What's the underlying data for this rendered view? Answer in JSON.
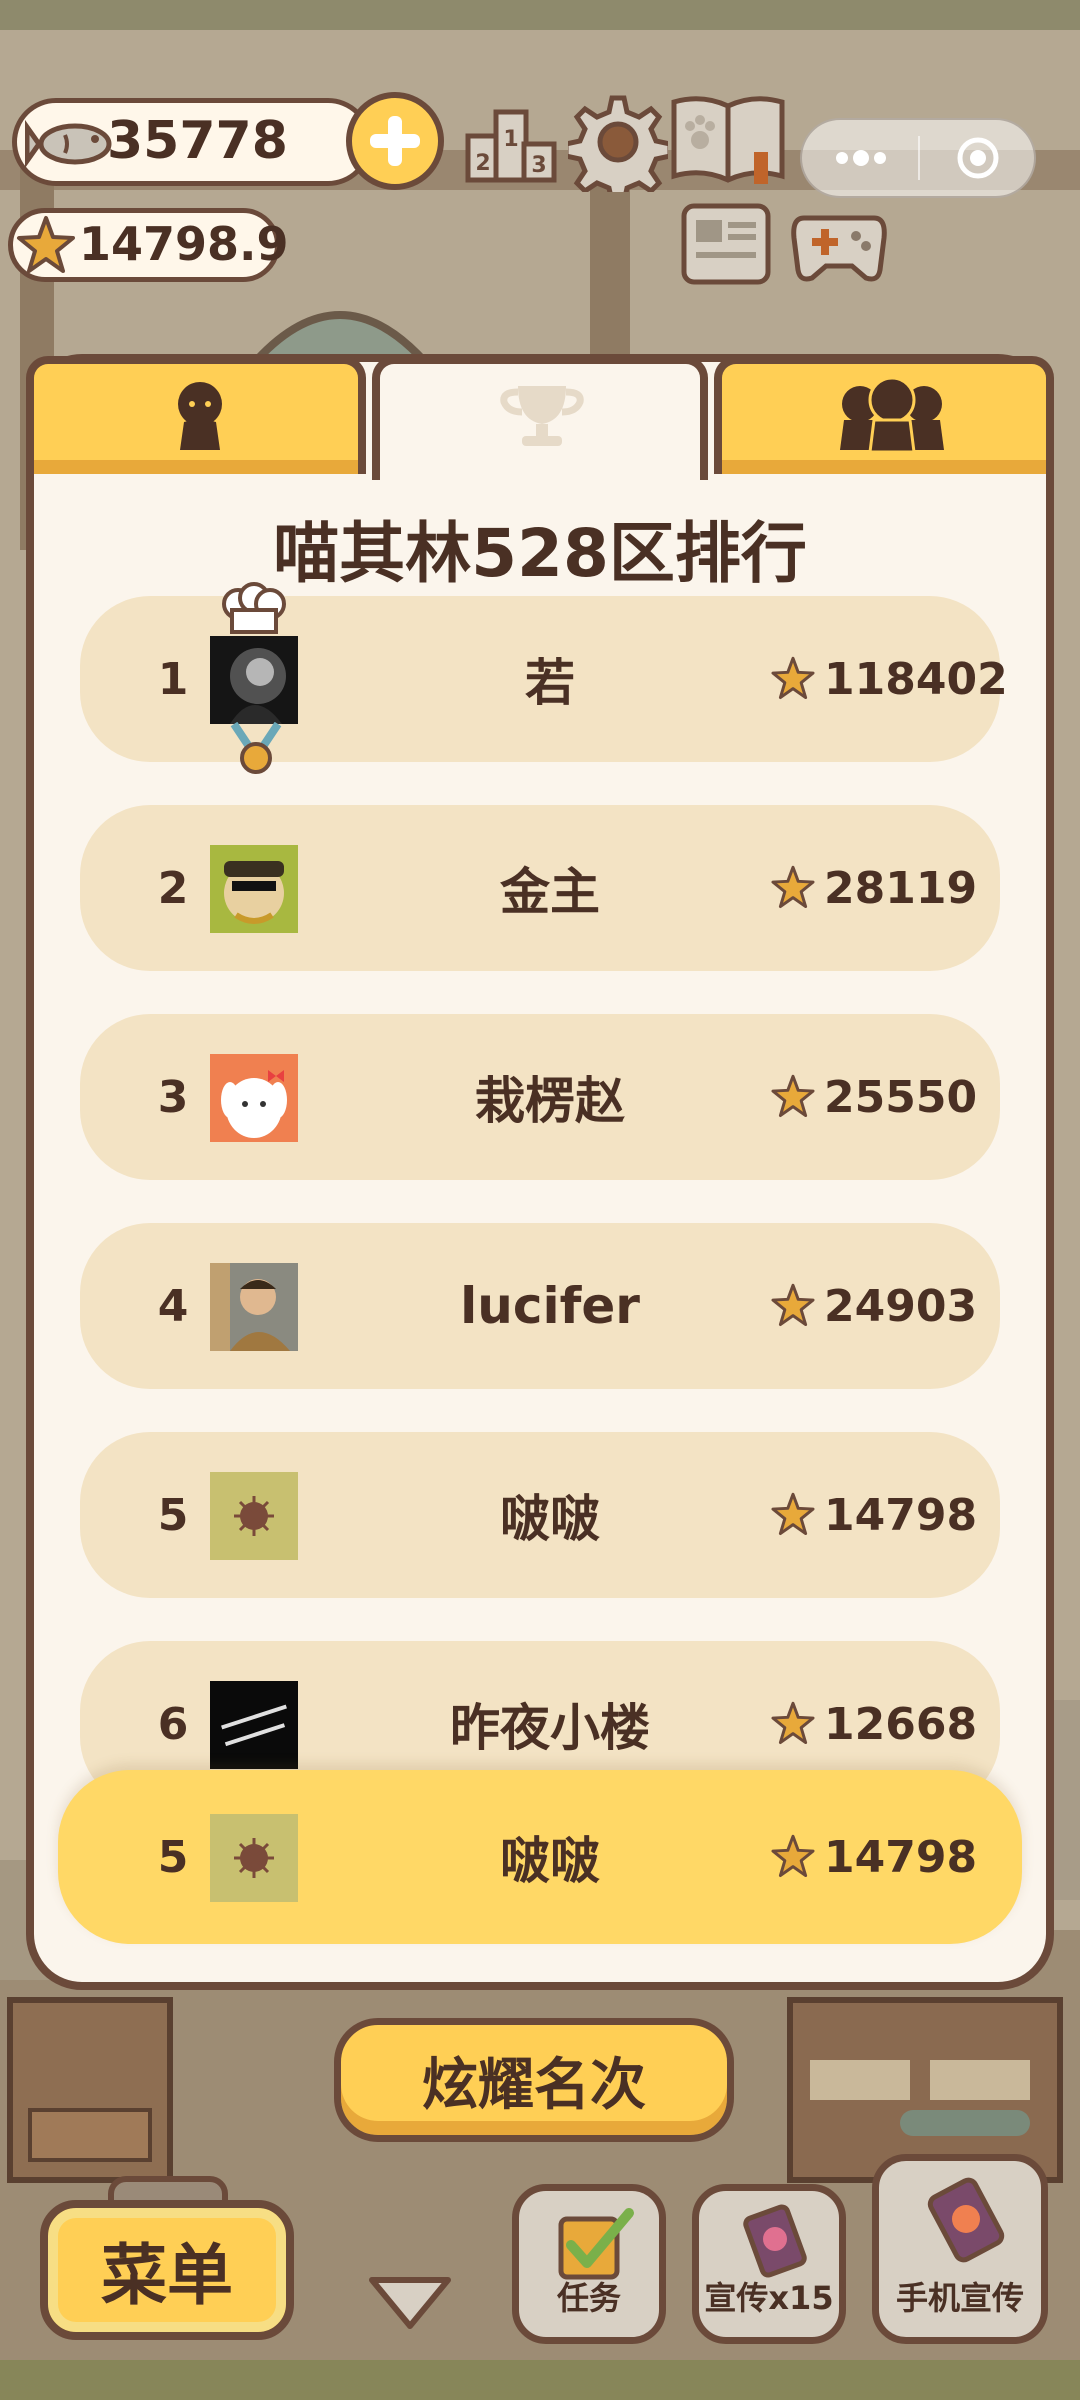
{
  "currencies": {
    "fish": "35778",
    "stars": "14798.9"
  },
  "panel": {
    "title": "喵其林528区排行",
    "tabs": [
      {
        "name": "personal",
        "icon": "single-person-icon"
      },
      {
        "name": "ranking",
        "icon": "trophy-icon",
        "active": true
      },
      {
        "name": "group",
        "icon": "group-icon"
      }
    ],
    "rows": [
      {
        "rank": "1",
        "name": "若",
        "score": "118402"
      },
      {
        "rank": "2",
        "name": "金主",
        "score": "28119"
      },
      {
        "rank": "3",
        "name": "栽楞赵",
        "score": "25550"
      },
      {
        "rank": "4",
        "name": "lucifer",
        "score": "24903"
      },
      {
        "rank": "5",
        "name": "啵啵",
        "score": "14798"
      },
      {
        "rank": "6",
        "name": "昨夜小楼",
        "score": "12668"
      }
    ],
    "me": {
      "rank": "5",
      "name": "啵啵",
      "score": "14798"
    },
    "show_button": "炫耀名次"
  },
  "bottom": {
    "menu": "菜单",
    "tasks": "任务",
    "promo": "宣传x15",
    "phone_promo": "手机宣传"
  },
  "colors": {
    "accent": "#ffcf55",
    "outline": "#6b4a3a",
    "row": "#f3e3c4",
    "panel": "#fbf5ec",
    "text": "#4a3024"
  }
}
